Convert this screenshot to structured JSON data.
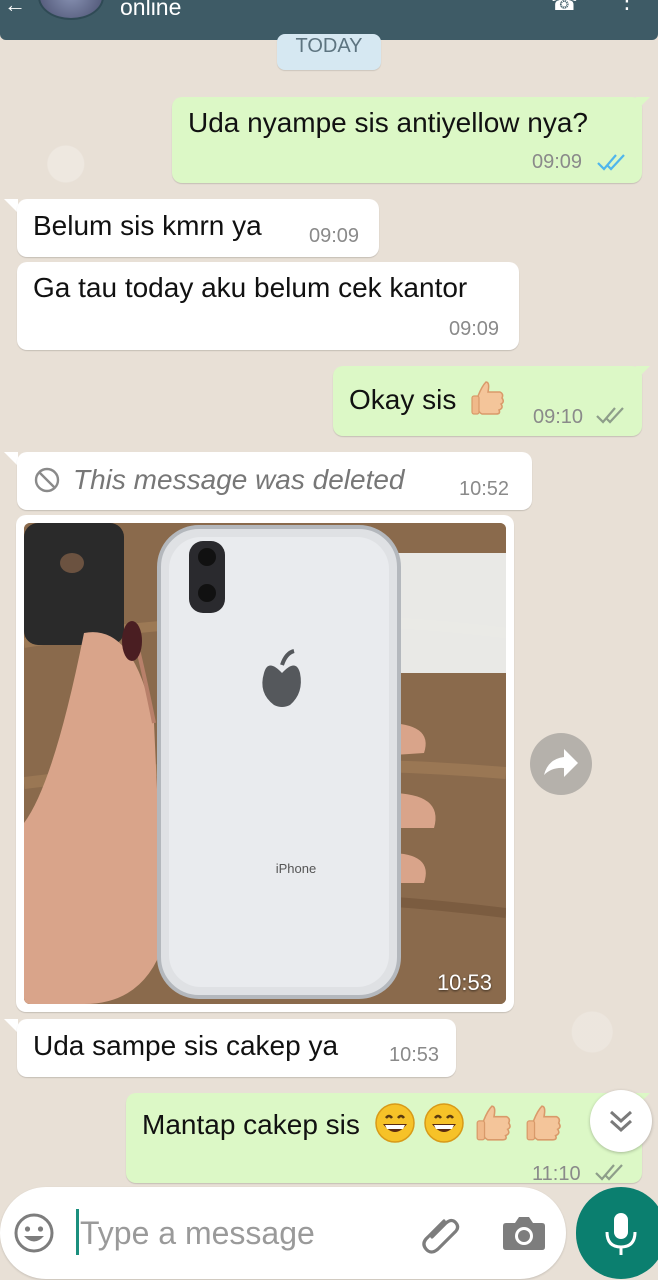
{
  "header": {
    "status": "online"
  },
  "day_chip": "TODAY",
  "messages": [
    {
      "text": "Uda nyampe sis antiyellow nya?",
      "time": "09:09"
    },
    {
      "text": "Belum sis kmrn ya",
      "time": "09:09"
    },
    {
      "text": "Ga tau today aku belum cek kantor",
      "time": "09:09"
    },
    {
      "text": "Okay sis",
      "time": "09:10"
    },
    {
      "text": "This message was deleted",
      "time": "10:52"
    },
    {
      "time": "10:53"
    },
    {
      "text": "Uda sampe sis cakep ya",
      "time": "10:53"
    },
    {
      "text": "Mantap cakep sis",
      "time": "11:10"
    }
  ],
  "photo": {
    "brand_text": "iPhone"
  },
  "input": {
    "placeholder": "Type a message"
  },
  "colors": {
    "header": "#3e5b66",
    "outgoing_bubble": "#dcf8c6",
    "incoming_bubble": "#ffffff",
    "read_ticks": "#4fb6ec",
    "accent": "#0b7f6f"
  }
}
